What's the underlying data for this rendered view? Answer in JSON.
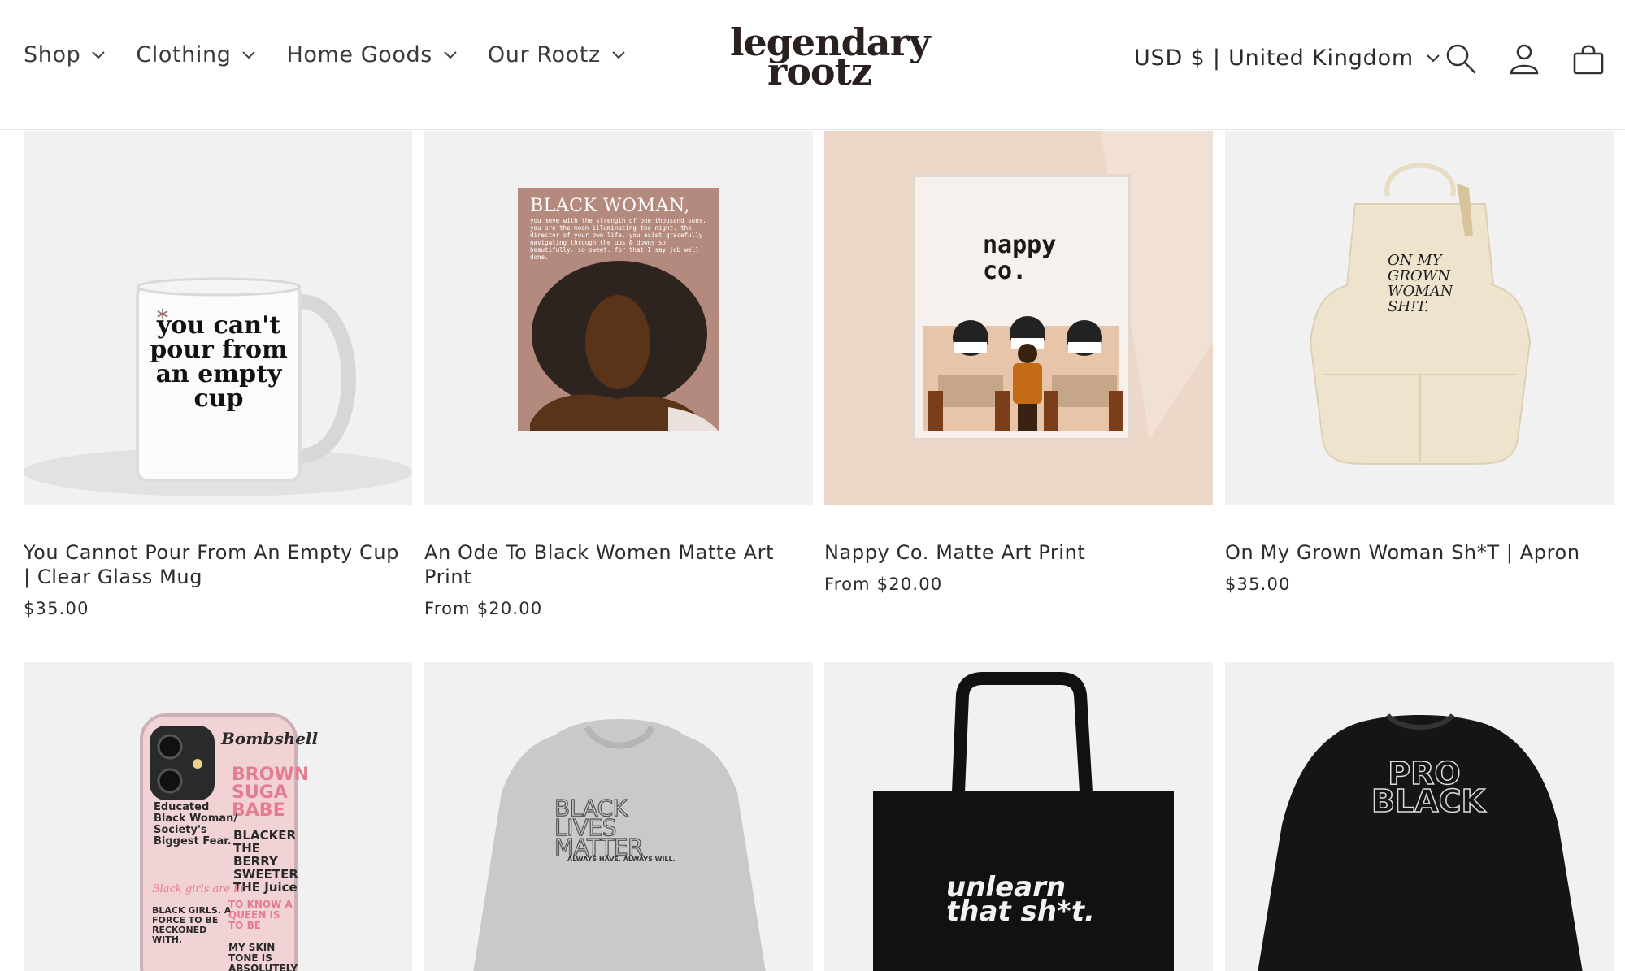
{
  "header": {
    "nav": [
      {
        "label": "Shop"
      },
      {
        "label": "Clothing"
      },
      {
        "label": "Home Goods"
      },
      {
        "label": "Our Rootz"
      }
    ],
    "logo_line1": "legendary",
    "logo_line2": "rootz",
    "currency": "USD $ | United Kingdom",
    "icons": [
      "search-icon",
      "account-icon",
      "cart-icon"
    ]
  },
  "products": [
    {
      "title": "You Cannot Pour From An Empty Cup | Clear Glass Mug",
      "price": "$35.00",
      "image_text": "you can't pour from an empty cup"
    },
    {
      "title": "An Ode To Black Women Matte Art Print",
      "price": "From $20.00",
      "image_heading": "BLACK WOMAN,",
      "image_text": "you move with the strength of one thousand suns. you are the moon illuminating the night. the director of your own life. you exist gracefully navigating through the ups & downs so beautifully. so sweet. for that I say job well done."
    },
    {
      "title": "Nappy Co. Matte Art Print",
      "price": "From $20.00",
      "image_text": "nappy co."
    },
    {
      "title": "On My Grown Woman Sh*T | Apron",
      "price": "$35.00",
      "image_text": "ON MY GROWN WOMAN SH!T."
    },
    {
      "image_title": "Bombshell",
      "image_text_1": "BROWN SUGA BABE",
      "image_text_2": "Educated Black Woman/ Society's Biggest Fear.",
      "image_text_3": "BLACKER THE BERRY SWEETER THE Juice",
      "image_text_4": "BLACK GIRLS. A FORCE TO BE RECKONED WITH.",
      "image_text_5": "TO KNOW A QUEEN IS TO BE",
      "image_text_6": "MY SKIN TONE IS ABSOLUTELY",
      "image_text_7": "Black girls are lit"
    },
    {
      "image_text": "BLACK LIVES MATTER",
      "image_subtext": "ALWAYS HAVE. ALWAYS WILL."
    },
    {
      "image_text_1": "unlearn",
      "image_text_2": "that sh*t."
    },
    {
      "image_text": "PRO BLACK"
    }
  ],
  "colors": {
    "card_bg": "#f1f1f1",
    "print_bg": "#ecdbd0",
    "accent_pink": "#e57c8f"
  }
}
